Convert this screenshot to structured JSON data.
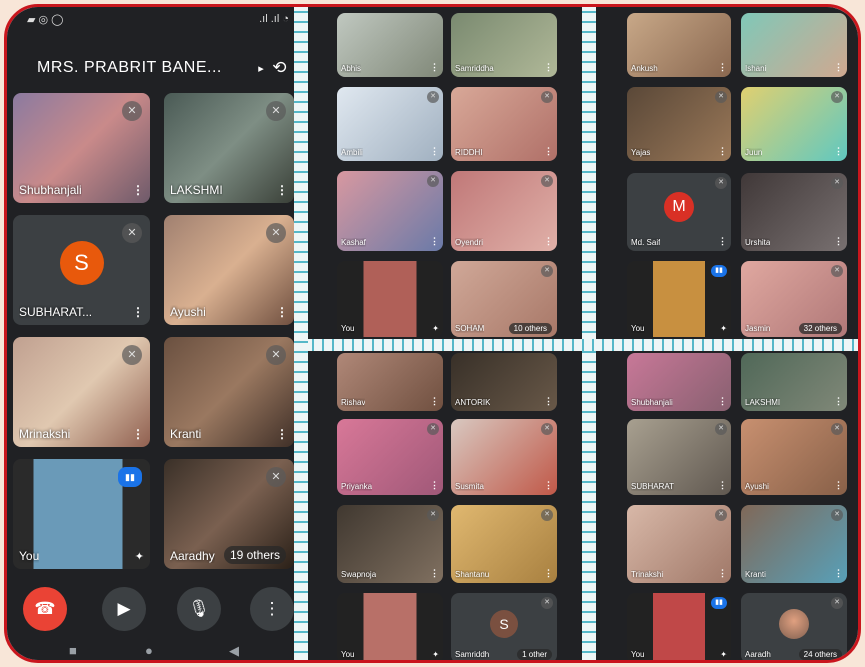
{
  "colors": {
    "border": "#c9161d",
    "background": "#f8e6d8",
    "call_bg": "#202124",
    "tile_bg": "#3c4043",
    "end_call": "#ea4335",
    "speaking": "#1a73e8",
    "avatar_orange": "#e8590c",
    "avatar_red": "#d93025",
    "divider_wave": "#56b8c8"
  },
  "main": {
    "title": "MRS. PRABRIT BANE...",
    "caret_icon": "▸",
    "flip_icon": "⟲",
    "status_left": "▰ ◎ ◯",
    "status_right": ".ıl .ıl ◔",
    "tiles": [
      {
        "name": "Shubhanjali"
      },
      {
        "name": "LAKSHMI"
      },
      {
        "name": "SUBHARAT...",
        "avatar": "S"
      },
      {
        "name": "Ayushi"
      },
      {
        "name": "Mrinakshi"
      },
      {
        "name": "Kranti"
      },
      {
        "name": "You"
      },
      {
        "name": "Aaradhy",
        "others": "19 others"
      }
    ],
    "controls": {
      "end_icon": "☎",
      "camera_icon": "▶",
      "mic_icon": "🎙",
      "more_icon": "⋮"
    },
    "nav": {
      "square": "■",
      "circle": "●",
      "back": "◀"
    }
  },
  "panels": {
    "top_left": [
      {
        "name": "Abhis"
      },
      {
        "name": "Samriddha"
      },
      {
        "name": "Ambili"
      },
      {
        "name": "RIDDHI"
      },
      {
        "name": "Kashaf"
      },
      {
        "name": "Oyendri"
      },
      {
        "name": "You"
      },
      {
        "name": "SOHAM",
        "others": "10 others"
      }
    ],
    "top_right": [
      {
        "name": "Ankush"
      },
      {
        "name": "Ishani"
      },
      {
        "name": "Yajas"
      },
      {
        "name": "Juun"
      },
      {
        "name": "Md. Saif",
        "avatar": "M"
      },
      {
        "name": "Urshita"
      },
      {
        "name": "You"
      },
      {
        "name": "Jasmin",
        "others": "32 others"
      }
    ],
    "bottom_left": [
      {
        "name": "Rishav"
      },
      {
        "name": "ANTORIK"
      },
      {
        "name": "Priyanka"
      },
      {
        "name": "Susmita"
      },
      {
        "name": "Swapnoja"
      },
      {
        "name": "Shantanu"
      },
      {
        "name": "You"
      },
      {
        "name": "Samriddh",
        "avatar": "S",
        "others": "1 other"
      }
    ],
    "bottom_right": [
      {
        "name": "Shubhanjali"
      },
      {
        "name": "LAKSHMI"
      },
      {
        "name": "SUBHARAT"
      },
      {
        "name": "Ayushi"
      },
      {
        "name": "Trinakshi"
      },
      {
        "name": "Kranti"
      },
      {
        "name": "You"
      },
      {
        "name": "Aaradh",
        "others": "24 others"
      }
    ]
  },
  "icons": {
    "mute": "mic-off-icon",
    "more": "more-vert-icon",
    "effects": "sparkle-icon",
    "speaking": "audio-level-icon"
  }
}
